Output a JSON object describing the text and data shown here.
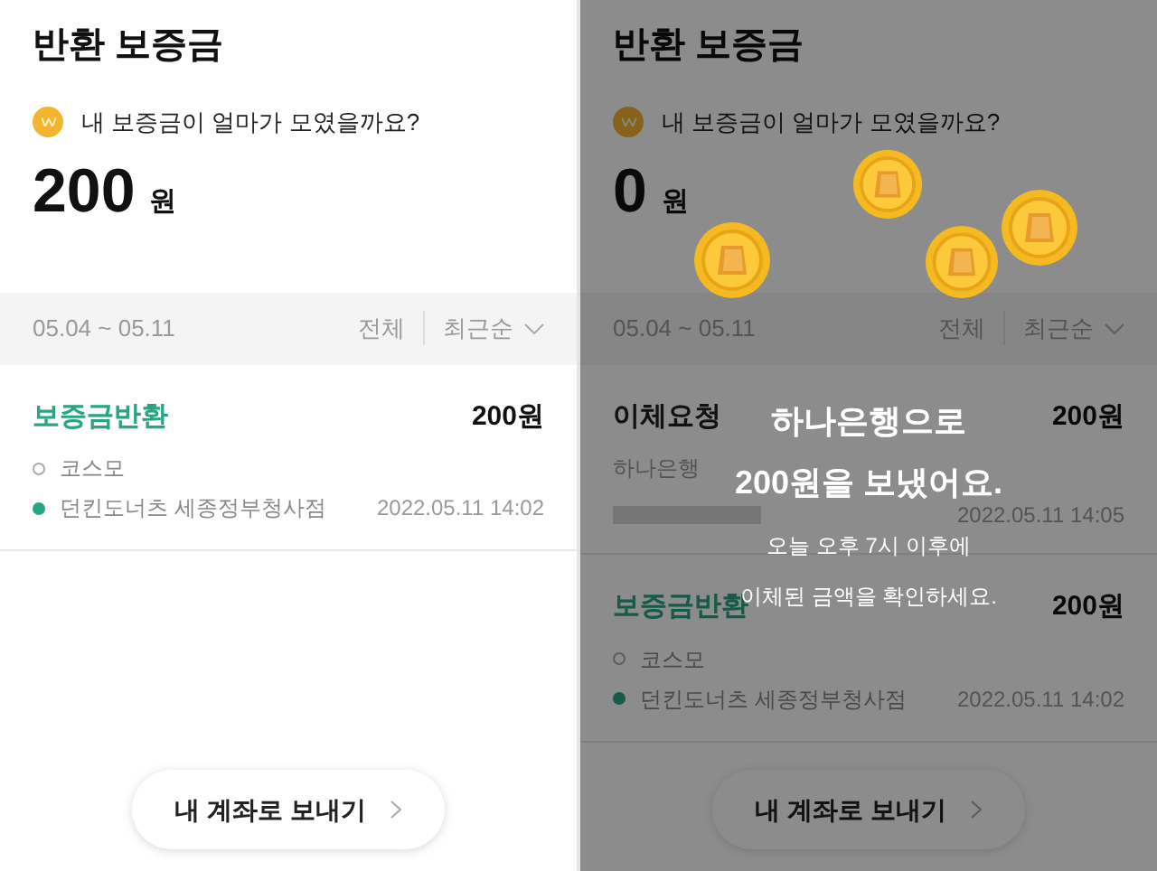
{
  "screens": [
    {
      "title": "반환 보증금",
      "question": "내 보증금이 얼마가 모였을까요?",
      "amount": "200",
      "unit": "원",
      "filter": {
        "range": "05.04 ~ 05.11",
        "type": "전체",
        "sort": "최근순"
      },
      "transactions": [
        {
          "kind": "return",
          "title": "보증금반환",
          "amount": "200원",
          "stops": [
            {
              "label": "코스모",
              "reached": false
            },
            {
              "label": "던킨도너츠 세종정부청사점",
              "reached": true
            }
          ],
          "date": "2022.05.11 14:02"
        }
      ],
      "button": "내 계좌로 보내기",
      "dimmed": false
    },
    {
      "title": "반환 보증금",
      "question": "내 보증금이 얼마가 모였을까요?",
      "amount": "0",
      "unit": "원",
      "filter": {
        "range": "05.04 ~ 05.11",
        "type": "전체",
        "sort": "최근순"
      },
      "transactions": [
        {
          "kind": "request",
          "title": "이체요청",
          "amount": "200원",
          "bank": "하나은행",
          "account_masked": true,
          "date": "2022.05.11 14:05"
        },
        {
          "kind": "return",
          "title": "보증금반환",
          "amount": "200원",
          "stops": [
            {
              "label": "코스모",
              "reached": false
            },
            {
              "label": "던킨도너츠 세종정부청사점",
              "reached": true
            }
          ],
          "date": "2022.05.11 14:02"
        }
      ],
      "button": "내 계좌로 보내기",
      "dimmed": true,
      "overlay": {
        "message_lines": [
          "하나은행으로",
          "200원을 보냈어요."
        ],
        "note_lines": [
          "오늘 오후 7시 이후에",
          "이체된 금액을 확인하세요."
        ]
      }
    }
  ]
}
